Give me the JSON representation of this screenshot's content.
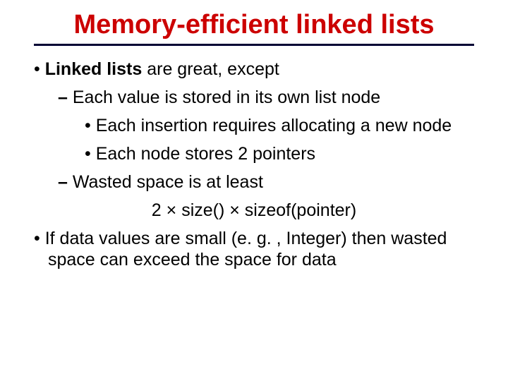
{
  "title": "Memory-efficient linked lists",
  "bullets": {
    "p1_prefix": "Linked lists",
    "p1_rest": " are great, except",
    "p1a": "Each value is stored in its own list node",
    "p1a_i": "Each insertion requires allocating a new node",
    "p1a_ii": "Each node stores 2 pointers",
    "p1b": "Wasted space is at least",
    "formula": "2 × size() × sizeof(pointer)",
    "p2": "If data values are small (e. g. , Integer) then wasted space can exceed the space for data"
  },
  "glyphs": {
    "dot": "•",
    "dash": "–"
  }
}
